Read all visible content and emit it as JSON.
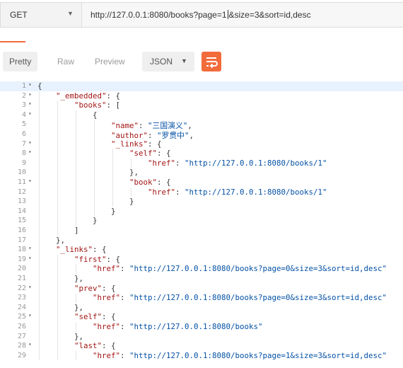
{
  "request": {
    "method": "GET",
    "url_before_cursor": "http://127.0.0.1:8080/books?page=1",
    "url_after_cursor": "&size=3&sort=id,desc"
  },
  "toolbar": {
    "tabs": [
      {
        "label": "Pretty",
        "active": true
      },
      {
        "label": "Raw",
        "active": false
      },
      {
        "label": "Preview",
        "active": false
      }
    ],
    "format": "JSON",
    "wrap_icon": "wrap-lines-icon"
  },
  "colors": {
    "accent": "#f26b3a",
    "key": "#a31515",
    "string": "#0451a5",
    "active_line": "#e8f2fe"
  },
  "editor": {
    "lines": [
      {
        "num": "1",
        "fold": true,
        "active": true,
        "indent": 0,
        "tokens": [
          {
            "t": "p",
            "v": "{"
          }
        ]
      },
      {
        "num": "2",
        "fold": true,
        "indent": 1,
        "tokens": [
          {
            "t": "k",
            "v": "\"_embedded\""
          },
          {
            "t": "p",
            "v": ": {"
          }
        ]
      },
      {
        "num": "3",
        "fold": true,
        "indent": 2,
        "tokens": [
          {
            "t": "k",
            "v": "\"books\""
          },
          {
            "t": "p",
            "v": ": ["
          }
        ]
      },
      {
        "num": "4",
        "fold": true,
        "indent": 3,
        "tokens": [
          {
            "t": "p",
            "v": "{"
          }
        ]
      },
      {
        "num": "5",
        "indent": 4,
        "tokens": [
          {
            "t": "k",
            "v": "\"name\""
          },
          {
            "t": "p",
            "v": ": "
          },
          {
            "t": "s",
            "v": "\"三国演义\""
          },
          {
            "t": "p",
            "v": ","
          }
        ]
      },
      {
        "num": "6",
        "indent": 4,
        "tokens": [
          {
            "t": "k",
            "v": "\"author\""
          },
          {
            "t": "p",
            "v": ": "
          },
          {
            "t": "s",
            "v": "\"罗贯中\""
          },
          {
            "t": "p",
            "v": ","
          }
        ]
      },
      {
        "num": "7",
        "fold": true,
        "indent": 4,
        "tokens": [
          {
            "t": "k",
            "v": "\"_links\""
          },
          {
            "t": "p",
            "v": ": {"
          }
        ]
      },
      {
        "num": "8",
        "fold": true,
        "indent": 5,
        "tokens": [
          {
            "t": "k",
            "v": "\"self\""
          },
          {
            "t": "p",
            "v": ": {"
          }
        ]
      },
      {
        "num": "9",
        "indent": 6,
        "tokens": [
          {
            "t": "k",
            "v": "\"href\""
          },
          {
            "t": "p",
            "v": ": "
          },
          {
            "t": "s",
            "v": "\"http://127.0.0.1:8080/books/1\""
          }
        ]
      },
      {
        "num": "10",
        "indent": 5,
        "tokens": [
          {
            "t": "p",
            "v": "},"
          }
        ]
      },
      {
        "num": "11",
        "fold": true,
        "indent": 5,
        "tokens": [
          {
            "t": "k",
            "v": "\"book\""
          },
          {
            "t": "p",
            "v": ": {"
          }
        ]
      },
      {
        "num": "12",
        "indent": 6,
        "tokens": [
          {
            "t": "k",
            "v": "\"href\""
          },
          {
            "t": "p",
            "v": ": "
          },
          {
            "t": "s",
            "v": "\"http://127.0.0.1:8080/books/1\""
          }
        ]
      },
      {
        "num": "13",
        "indent": 5,
        "tokens": [
          {
            "t": "p",
            "v": "}"
          }
        ]
      },
      {
        "num": "14",
        "indent": 4,
        "tokens": [
          {
            "t": "p",
            "v": "}"
          }
        ]
      },
      {
        "num": "15",
        "indent": 3,
        "tokens": [
          {
            "t": "p",
            "v": "}"
          }
        ]
      },
      {
        "num": "16",
        "indent": 2,
        "tokens": [
          {
            "t": "p",
            "v": "]"
          }
        ]
      },
      {
        "num": "17",
        "indent": 1,
        "tokens": [
          {
            "t": "p",
            "v": "},"
          }
        ]
      },
      {
        "num": "18",
        "fold": true,
        "indent": 1,
        "tokens": [
          {
            "t": "k",
            "v": "\"_links\""
          },
          {
            "t": "p",
            "v": ": {"
          }
        ]
      },
      {
        "num": "19",
        "fold": true,
        "indent": 2,
        "tokens": [
          {
            "t": "k",
            "v": "\"first\""
          },
          {
            "t": "p",
            "v": ": {"
          }
        ]
      },
      {
        "num": "20",
        "indent": 3,
        "tokens": [
          {
            "t": "k",
            "v": "\"href\""
          },
          {
            "t": "p",
            "v": ": "
          },
          {
            "t": "s",
            "v": "\"http://127.0.0.1:8080/books?page=0&size=3&sort=id,desc\""
          }
        ]
      },
      {
        "num": "21",
        "indent": 2,
        "tokens": [
          {
            "t": "p",
            "v": "},"
          }
        ]
      },
      {
        "num": "22",
        "fold": true,
        "indent": 2,
        "tokens": [
          {
            "t": "k",
            "v": "\"prev\""
          },
          {
            "t": "p",
            "v": ": {"
          }
        ]
      },
      {
        "num": "23",
        "indent": 3,
        "tokens": [
          {
            "t": "k",
            "v": "\"href\""
          },
          {
            "t": "p",
            "v": ": "
          },
          {
            "t": "s",
            "v": "\"http://127.0.0.1:8080/books?page=0&size=3&sort=id,desc\""
          }
        ]
      },
      {
        "num": "24",
        "indent": 2,
        "tokens": [
          {
            "t": "p",
            "v": "},"
          }
        ]
      },
      {
        "num": "25",
        "fold": true,
        "indent": 2,
        "tokens": [
          {
            "t": "k",
            "v": "\"self\""
          },
          {
            "t": "p",
            "v": ": {"
          }
        ]
      },
      {
        "num": "26",
        "indent": 3,
        "tokens": [
          {
            "t": "k",
            "v": "\"href\""
          },
          {
            "t": "p",
            "v": ": "
          },
          {
            "t": "s",
            "v": "\"http://127.0.0.1:8080/books\""
          }
        ]
      },
      {
        "num": "27",
        "indent": 2,
        "tokens": [
          {
            "t": "p",
            "v": "},"
          }
        ]
      },
      {
        "num": "28",
        "fold": true,
        "indent": 2,
        "tokens": [
          {
            "t": "k",
            "v": "\"last\""
          },
          {
            "t": "p",
            "v": ": {"
          }
        ]
      },
      {
        "num": "29",
        "indent": 3,
        "tokens": [
          {
            "t": "k",
            "v": "\"href\""
          },
          {
            "t": "p",
            "v": ": "
          },
          {
            "t": "s",
            "v": "\"http://127.0.0.1:8080/books?page=1&size=3&sort=id,desc\""
          }
        ]
      }
    ]
  }
}
